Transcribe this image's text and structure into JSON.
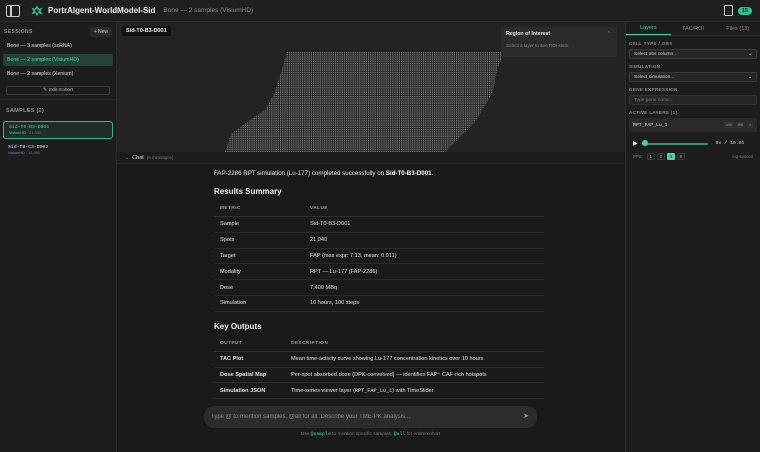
{
  "header": {
    "app_title": "PortrAlgent-WorldModel-Sid",
    "subtitle": "Bone — 2 samples (VisiumHD)",
    "badge_count": "15"
  },
  "sidebar": {
    "sessions_title": "SESSIONS",
    "new_label": "+ New",
    "sessions": [
      {
        "label": "Bone — 3 samples (scRNA)"
      },
      {
        "label": "Bone — 2 samples (VisiumHD)"
      },
      {
        "label": "Bone — 2 samples (Xenium)"
      }
    ],
    "edit_cohort_label": "Edit Cohort",
    "samples_title": "SAMPLES (2)",
    "samples": [
      {
        "name": "Sid-T0-B3-D001",
        "modality": "VisiumHD",
        "spots": "21,040"
      },
      {
        "name": "Sid-T0-C3-D002",
        "modality": "VisiumHD",
        "spots": "18,990"
      }
    ]
  },
  "viewer": {
    "sample_label": "Sid-T0-B3-D001",
    "roi_title": "Region of Interest",
    "roi_text": "Select a layer to see ROI stats."
  },
  "chat": {
    "label": "Chat",
    "count": "(6 messages)",
    "message_prefix": "FAP-2286 RPT simulation (Lu-177) completed successfully on ",
    "message_sample": "Sid-T0-B3-D001",
    "message_suffix": ".",
    "results_title": "Results Summary",
    "results_headers": [
      "METRIC",
      "VALUE"
    ],
    "results_rows": [
      [
        "Sample",
        "Sid-T0-B3-D001"
      ],
      [
        "Spots",
        "21,040"
      ],
      [
        "Target",
        "FAP (max expr: 7.13, mean: 0.011)"
      ],
      [
        "Modality",
        "RPT — Lu-177 (FAP-2286)"
      ],
      [
        "Dose",
        "7,400 MBq"
      ],
      [
        "Simulation",
        "10 hours, 100 steps"
      ]
    ],
    "outputs_title": "Key Outputs",
    "outputs_headers": [
      "OUTPUT",
      "DESCRIPTION"
    ],
    "outputs_rows": [
      [
        "TAC Plot",
        "Mean time-activity curve showing Lu-177 concentration kinetics over 10 hours"
      ],
      [
        "Dose Spatial Map",
        "Per-spot absorbed dose (DPK-convolved) — identifies FAP⁺ CAF-rich hotspots"
      ]
    ],
    "json_row": {
      "name": "Simulation JSON",
      "pre": "Time-series viewer layer (",
      "code": "RPT_FAP_Lu_1",
      "post": ") with TimeSlider"
    },
    "input_placeholder": "Type @ to mention samples, @all for all. Describe your TME-PK analysis...",
    "hint_pre": "Use ",
    "hint_code1": "@sample",
    "hint_mid": " to mention specific samples, ",
    "hint_code2": "@all",
    "hint_post": " for entire cohort"
  },
  "right_panel": {
    "tabs": [
      "Layers",
      "TAC/ROI",
      "Files (13)"
    ],
    "cell_type_label": "CELL TYPE / OBS",
    "cell_type_value": "Select obs column...",
    "simulation_label": "SIMULATION",
    "simulation_value": "Select simulation...",
    "gene_label": "GENE EXPRESSION",
    "gene_placeholder": "Type gene name...",
    "active_layers_label": "ACTIVE LAYERS (1)",
    "layer_name": "RPT_FAP_Lu_1",
    "layer_pill1": "sim",
    "layer_pill2": "0%",
    "time": "0s / 10.0h",
    "time_progress": 0,
    "fps_label": "FPS:",
    "fps_options": [
      "1",
      "2",
      "4",
      "8"
    ],
    "fps_selected": "4",
    "interp_label": "log-spaced"
  }
}
